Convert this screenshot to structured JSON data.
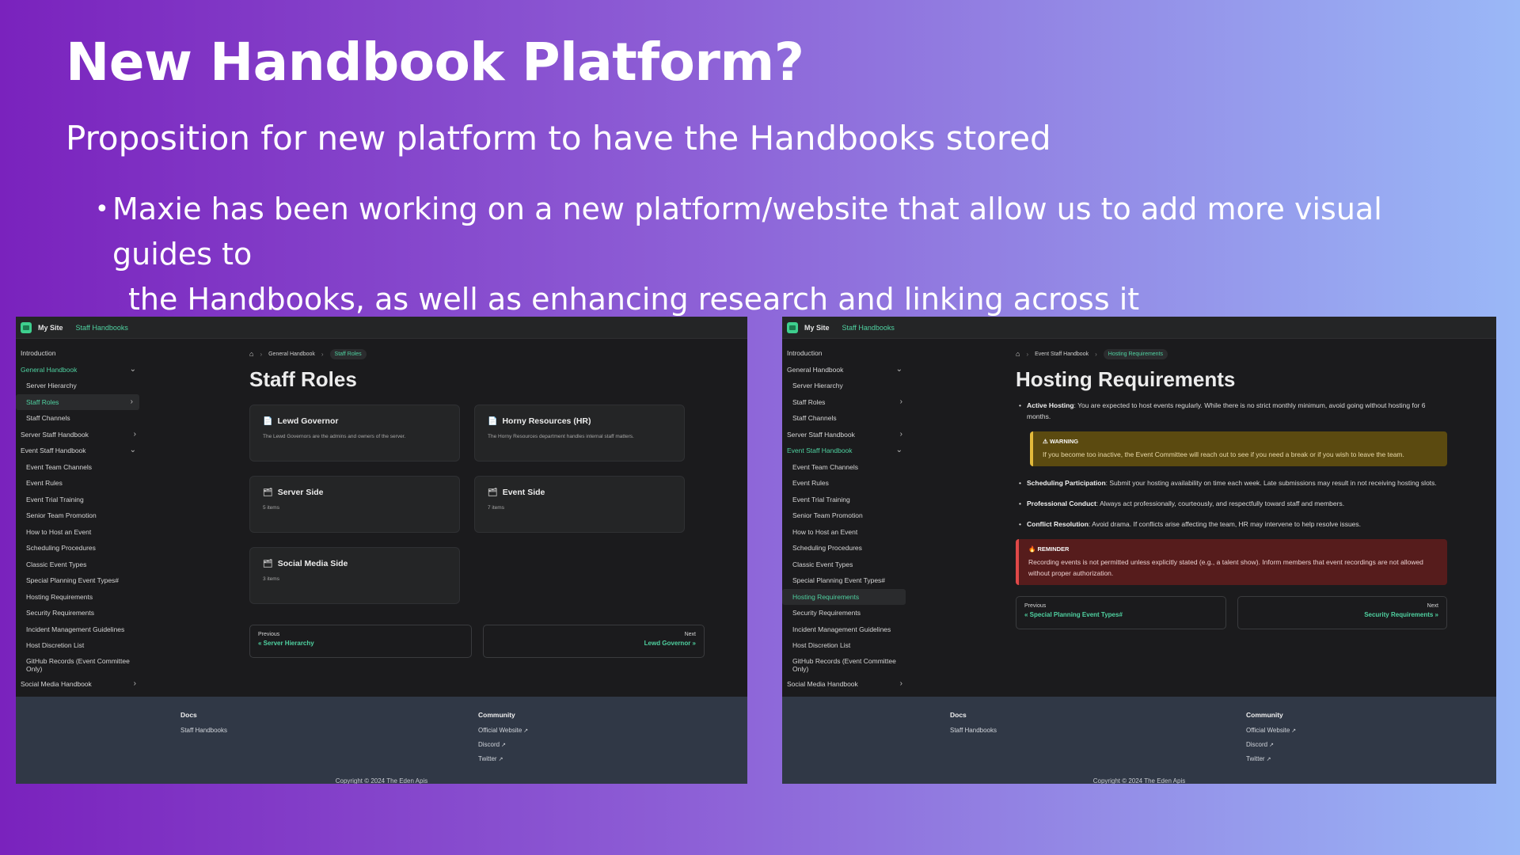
{
  "slide": {
    "title": "New Handbook Platform?",
    "subtitle": "Proposition for new platform to have the Handbooks stored",
    "bullet_line1": "Maxie has been working on a new platform/website that allow us to add more visual guides to",
    "bullet_line2": "the Handbooks, as well as enhancing research and linking across it"
  },
  "left": {
    "site_name": "My Site",
    "site_link": "Staff Handbooks",
    "sidebar": [
      {
        "label": "Introduction"
      },
      {
        "label": "General Handbook"
      },
      {
        "label": "Server Hierarchy"
      },
      {
        "label": "Staff Roles"
      },
      {
        "label": "Staff Channels"
      },
      {
        "label": "Server Staff Handbook"
      },
      {
        "label": "Event Staff Handbook"
      },
      {
        "label": "Event Team Channels"
      },
      {
        "label": "Event Rules"
      },
      {
        "label": "Event Trial Training"
      },
      {
        "label": "Senior Team Promotion"
      },
      {
        "label": "How to Host an Event"
      },
      {
        "label": "Scheduling Procedures"
      },
      {
        "label": "Classic Event Types"
      },
      {
        "label": "Special Planning Event Types#"
      },
      {
        "label": "Hosting Requirements"
      },
      {
        "label": "Security Requirements"
      },
      {
        "label": "Incident Management Guidelines"
      },
      {
        "label": "Host Discretion List"
      },
      {
        "label": "GitHub Records (Event Committee Only)"
      },
      {
        "label": "Social Media Handbook"
      }
    ],
    "breadcrumb": [
      "General Handbook",
      "Staff Roles"
    ],
    "page_title": "Staff Roles",
    "cards": [
      {
        "icon": "📄",
        "title": "Lewd Governor",
        "desc": "The Lewd Governors are the admins and owners of the server."
      },
      {
        "icon": "📄",
        "title": "Horny Resources (HR)",
        "desc": "The Horny Resources department handles internal staff matters."
      },
      {
        "icon": "🗂",
        "title": "Server Side",
        "desc": "5 items"
      },
      {
        "icon": "🗂",
        "title": "Event Side",
        "desc": "7 items"
      },
      {
        "icon": "🗂",
        "title": "Social Media Side",
        "desc": "3 items"
      }
    ],
    "pager": {
      "prev_label": "Previous",
      "prev_link": "« Server Hierarchy",
      "next_label": "Next",
      "next_link": "Lewd Governor »"
    },
    "footer": {
      "docs_head": "Docs",
      "docs_links": [
        "Staff Handbooks"
      ],
      "community_head": "Community",
      "community_links": [
        "Official Website",
        "Discord",
        "Twitter"
      ],
      "copyright": "Copyright © 2024 The Eden Apis"
    }
  },
  "right": {
    "site_name": "My Site",
    "site_link": "Staff Handbooks",
    "sidebar": [
      {
        "label": "Introduction"
      },
      {
        "label": "General Handbook"
      },
      {
        "label": "Server Hierarchy"
      },
      {
        "label": "Staff Roles"
      },
      {
        "label": "Staff Channels"
      },
      {
        "label": "Server Staff Handbook"
      },
      {
        "label": "Event Staff Handbook"
      },
      {
        "label": "Event Team Channels"
      },
      {
        "label": "Event Rules"
      },
      {
        "label": "Event Trial Training"
      },
      {
        "label": "Senior Team Promotion"
      },
      {
        "label": "How to Host an Event"
      },
      {
        "label": "Scheduling Procedures"
      },
      {
        "label": "Classic Event Types"
      },
      {
        "label": "Special Planning Event Types#"
      },
      {
        "label": "Hosting Requirements"
      },
      {
        "label": "Security Requirements"
      },
      {
        "label": "Incident Management Guidelines"
      },
      {
        "label": "Host Discretion List"
      },
      {
        "label": "GitHub Records (Event Committee Only)"
      },
      {
        "label": "Social Media Handbook"
      }
    ],
    "breadcrumb": [
      "Event Staff Handbook",
      "Hosting Requirements"
    ],
    "page_title": "Hosting Requirements",
    "items": [
      {
        "bold": "Active Hosting",
        "text": ": You are expected to host events regularly. While there is no strict monthly minimum, avoid going without hosting for 6 months."
      },
      {
        "bold": "Scheduling Participation",
        "text": ": Submit your hosting availability on time each week. Late submissions may result in not receiving hosting slots."
      },
      {
        "bold": "Professional Conduct",
        "text": ": Always act professionally, courteously, and respectfully toward staff and members."
      },
      {
        "bold": "Conflict Resolution",
        "text": ": Avoid drama. If conflicts arise affecting the team, HR may intervene to help resolve issues."
      }
    ],
    "warning": {
      "title": "WARNING",
      "text": "If you become too inactive, the Event Committee will reach out to see if you need a break or if you wish to leave the team."
    },
    "reminder": {
      "title": "REMINDER",
      "text": "Recording events is not permitted unless explicitly stated (e.g., a talent show). Inform members that event recordings are not allowed without proper authorization."
    },
    "pager": {
      "prev_label": "Previous",
      "prev_link": "« Special Planning Event Types#",
      "next_label": "Next",
      "next_link": "Security Requirements »"
    },
    "footer": {
      "docs_head": "Docs",
      "docs_links": [
        "Staff Handbooks"
      ],
      "community_head": "Community",
      "community_links": [
        "Official Website",
        "Discord",
        "Twitter"
      ],
      "copyright": "Copyright © 2024 The Eden Apis"
    }
  }
}
